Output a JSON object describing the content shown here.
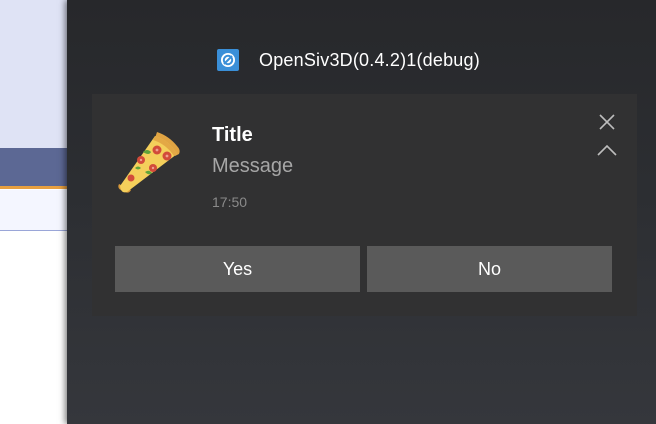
{
  "app": {
    "name": "OpenSiv3D(0.4.2)1(debug)",
    "icon": "opensiv3d-app-icon"
  },
  "notification": {
    "title": "Title",
    "message": "Message",
    "time": "17:50",
    "image": "pizza-slice-icon",
    "actions": {
      "yes_label": "Yes",
      "no_label": "No"
    },
    "controls": {
      "close": "close-icon",
      "collapse": "chevron-up-icon"
    }
  },
  "colors": {
    "panel_bg": "#2d2f33",
    "toast_bg": "#313132",
    "button_bg": "#5a5a5a",
    "app_icon": "#3a8fd8"
  }
}
